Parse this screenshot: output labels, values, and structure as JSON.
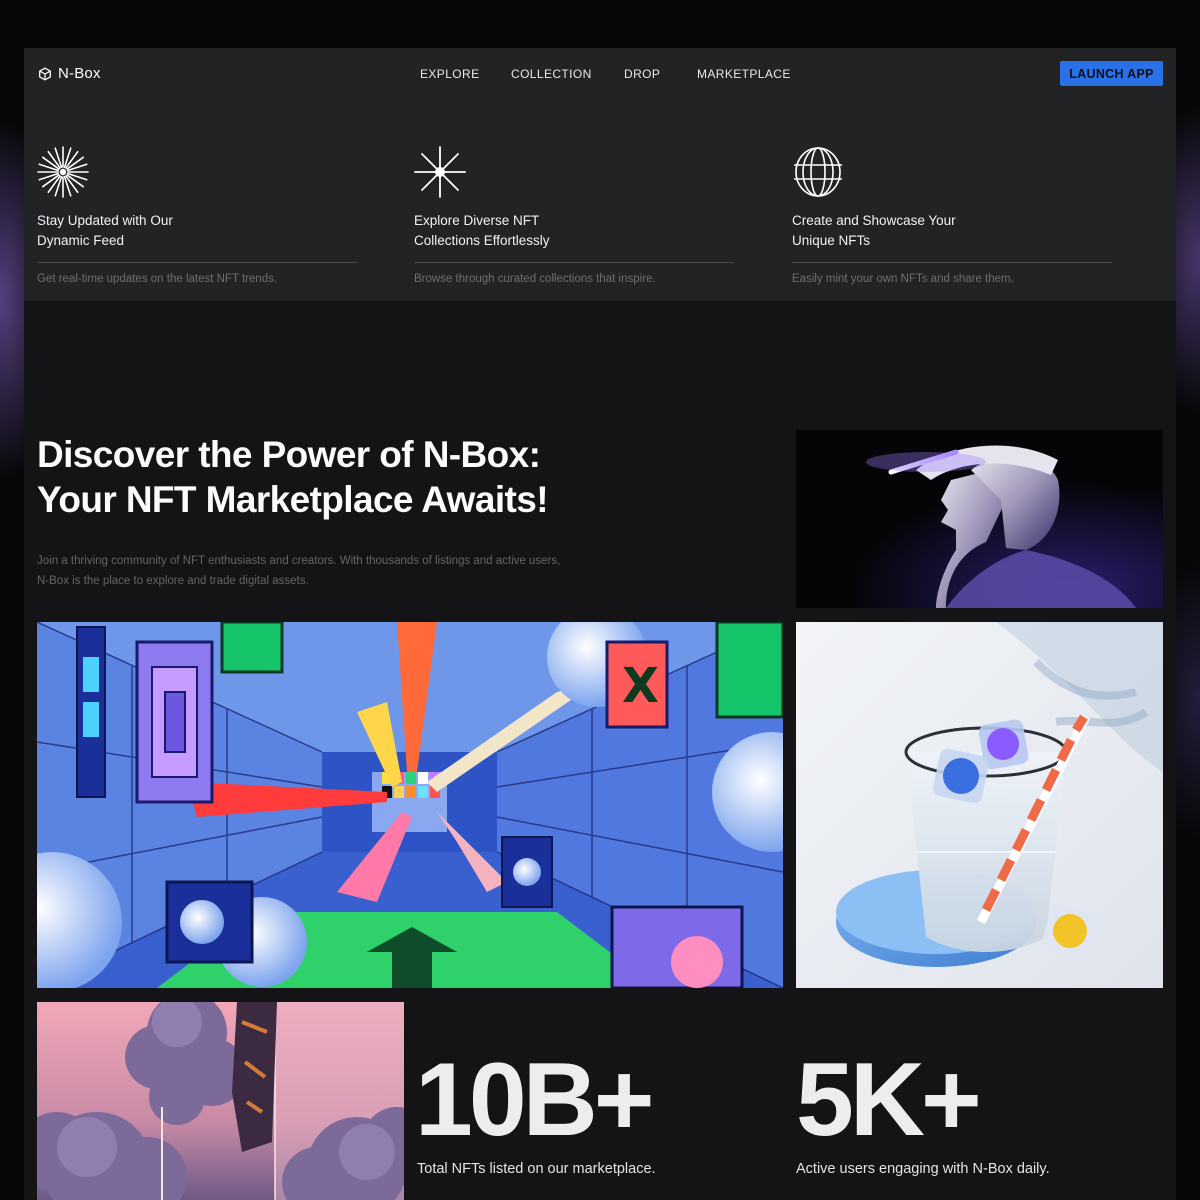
{
  "brand": {
    "name": "N-Box"
  },
  "nav": {
    "items": [
      {
        "label": "EXPLORE"
      },
      {
        "label": "COLLECTION"
      },
      {
        "label": "DROP"
      },
      {
        "label": "MARKETPLACE"
      }
    ],
    "cta": "LAUNCH APP"
  },
  "features": [
    {
      "icon": "starburst-icon",
      "title_line1": "Stay Updated with Our",
      "title_line2": "Dynamic Feed",
      "description": "Get real-time updates on the latest NFT trends."
    },
    {
      "icon": "spark-icon",
      "title_line1": "Explore Diverse NFT",
      "title_line2": "Collections Effortlessly",
      "description": "Browse through curated collections that inspire."
    },
    {
      "icon": "rings-icon",
      "title_line1": "Create and Showcase Your",
      "title_line2": "Unique NFTs",
      "description": "Easily mint your own NFTs and share them."
    }
  ],
  "hero": {
    "title_line1": "Discover the Power of N-Box:",
    "title_line2": "Your NFT Marketplace Awaits!",
    "text_line1": "Join a thriving community of NFT enthusiasts and creators. With thousands of listings and active users,",
    "text_line2": "N-Box is the place to explore and trade digital assets."
  },
  "stats": [
    {
      "value": "10B+",
      "label": "Total NFTs listed on our marketplace."
    },
    {
      "value": "5K+",
      "label": "Active users engaging with N-Box daily."
    }
  ],
  "colors": {
    "accent": "#2a70e6",
    "panel": "#232224",
    "background": "#141315"
  }
}
